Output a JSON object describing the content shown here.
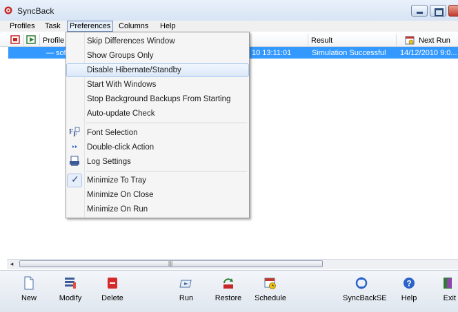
{
  "window": {
    "title": "SyncBack"
  },
  "menubar": {
    "items": [
      {
        "label": "Profiles"
      },
      {
        "label": "Task"
      },
      {
        "label": "Preferences"
      },
      {
        "label": "Columns"
      },
      {
        "label": "Help"
      }
    ]
  },
  "list": {
    "columns": {
      "profile": "Profile",
      "result": "Result",
      "next_run": "Next Run"
    },
    "selected_row": {
      "name": "— sof",
      "last_run_partial": "10 13:11:01",
      "result": "Simulation Successful",
      "next_run": "14/12/2010 9:0..."
    }
  },
  "scrollbar": {
    "left_arrow": "◂",
    "grip": "|||"
  },
  "preferences_menu": {
    "items": [
      {
        "label": "Skip Differences Window"
      },
      {
        "label": "Show Groups Only"
      },
      {
        "label": "Disable Hibernate/Standby",
        "highlighted": true
      },
      {
        "label": "Start With Windows"
      },
      {
        "label": "Stop Background Backups From Starting"
      },
      {
        "label": "Auto-update Check"
      },
      {
        "label": "Font Selection",
        "icon": "font-icon"
      },
      {
        "label": "Double-click Action",
        "icon": "double-arrow-icon"
      },
      {
        "label": "Log Settings",
        "icon": "log-icon"
      },
      {
        "label": "Minimize To Tray",
        "checked": true
      },
      {
        "label": "Minimize On Close"
      },
      {
        "label": "Minimize On Run"
      }
    ],
    "check_glyph": "✓"
  },
  "toolbar": {
    "buttons": [
      {
        "label": "New",
        "icon": "new-document-icon"
      },
      {
        "label": "Modify",
        "icon": "modify-list-icon"
      },
      {
        "label": "Delete",
        "icon": "delete-icon"
      },
      {
        "label": "Run",
        "icon": "run-icon"
      },
      {
        "label": "Restore",
        "icon": "restore-icon"
      },
      {
        "label": "Schedule",
        "icon": "schedule-icon"
      },
      {
        "label": "SyncBackSE",
        "icon": "syncbackse-icon"
      },
      {
        "label": "Help",
        "icon": "help-icon"
      },
      {
        "label": "Exit",
        "icon": "exit-icon"
      }
    ]
  },
  "colors": {
    "selection": "#3399ff",
    "menu_highlight_border": "#a8c8ec",
    "delete_red": "#d42a2a",
    "help_blue": "#2b63c9"
  }
}
